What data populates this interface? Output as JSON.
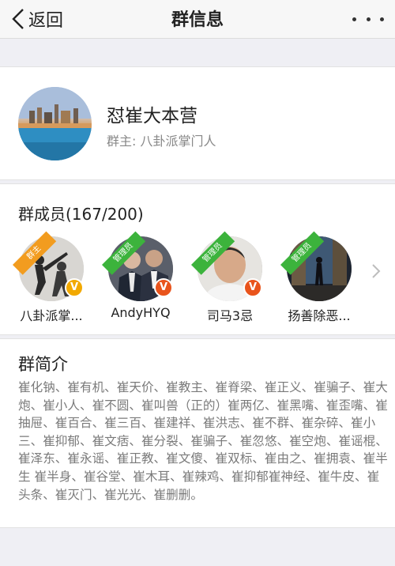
{
  "nav": {
    "back_label": "返回",
    "title": "群信息"
  },
  "group": {
    "name": "怼崔大本营",
    "owner": "群主: 八卦派掌门人"
  },
  "members": {
    "title": "群成员(167/200)",
    "list": [
      {
        "name": "八卦派掌...",
        "ribbon": "群主",
        "badge": "V"
      },
      {
        "name": "AndyHYQ",
        "ribbon": "管理员",
        "badge": "V"
      },
      {
        "name": "司马3忌",
        "ribbon": "管理员",
        "badge": "V"
      },
      {
        "name": "扬善除恶...",
        "ribbon": "管理员",
        "badge": ""
      }
    ]
  },
  "intro": {
    "title": "群简介",
    "text": "崔化钠、崔有机、崔天价、崔教主、崔脊梁、崔正义、崔骗子、崔大炮、崔小人、崔不圆、崔叫兽（正的）崔两亿、崔黑嘴、崔歪嘴、崔抽屉、崔百合、崔三百、崔建祥、崔洪志、崔不群、崔杂碎、崔小三、崔抑郁、崔文痞、崔分裂、崔骗子、崔忽悠、崔空炮、崔谣棍、崔泽东、崔永谣、崔正教、崔文傻、崔双标、崔由之、崔拥袁、崔半生 崔半身、崔谷堂、崔木耳、崔辣鸡、崔抑郁崔神经、崔牛皮、崔头条、崔灭门、崔光光、崔删删。"
  },
  "colors": {
    "owner_ribbon": "#f29c1f",
    "admin_ribbon": "#3cb33c",
    "badge": "#f2a900"
  }
}
